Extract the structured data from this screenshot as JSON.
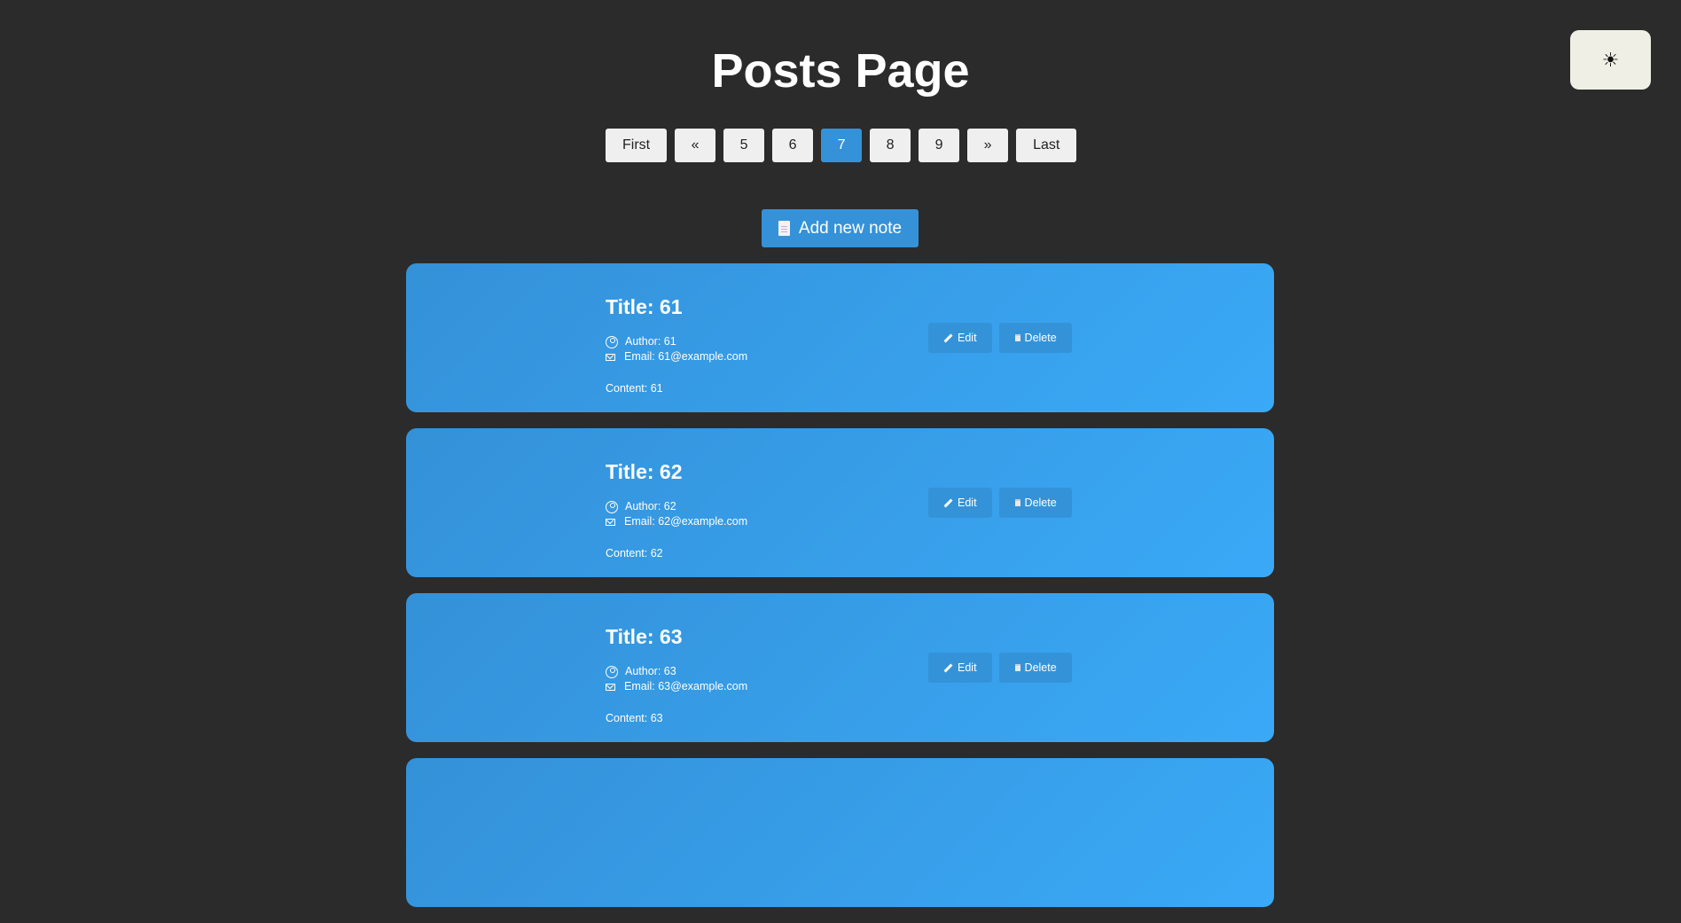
{
  "theme_toggle": {
    "icon": "☀"
  },
  "page": {
    "title": "Posts Page"
  },
  "pagination": {
    "first": "First",
    "prev": "«",
    "pages": [
      "5",
      "6",
      "7",
      "8",
      "9"
    ],
    "active": "7",
    "next": "»",
    "last": "Last"
  },
  "add_note": {
    "label": "Add new note"
  },
  "posts": [
    {
      "title": "Title: 61",
      "author": "Author: 61",
      "email": "Email: 61@example.com",
      "content": "Content: 61",
      "edit": "Edit",
      "delete": "Delete"
    },
    {
      "title": "Title: 62",
      "author": "Author: 62",
      "email": "Email: 62@example.com",
      "content": "Content: 62",
      "edit": "Edit",
      "delete": "Delete"
    },
    {
      "title": "Title: 63",
      "author": "Author: 63",
      "email": "Email: 63@example.com",
      "content": "Content: 63",
      "edit": "Edit",
      "delete": "Delete"
    }
  ],
  "colors": {
    "background": "#2b2b2b",
    "accent": "#3592d9",
    "card_start": "#3491d8",
    "card_end": "#3aa9f7"
  }
}
